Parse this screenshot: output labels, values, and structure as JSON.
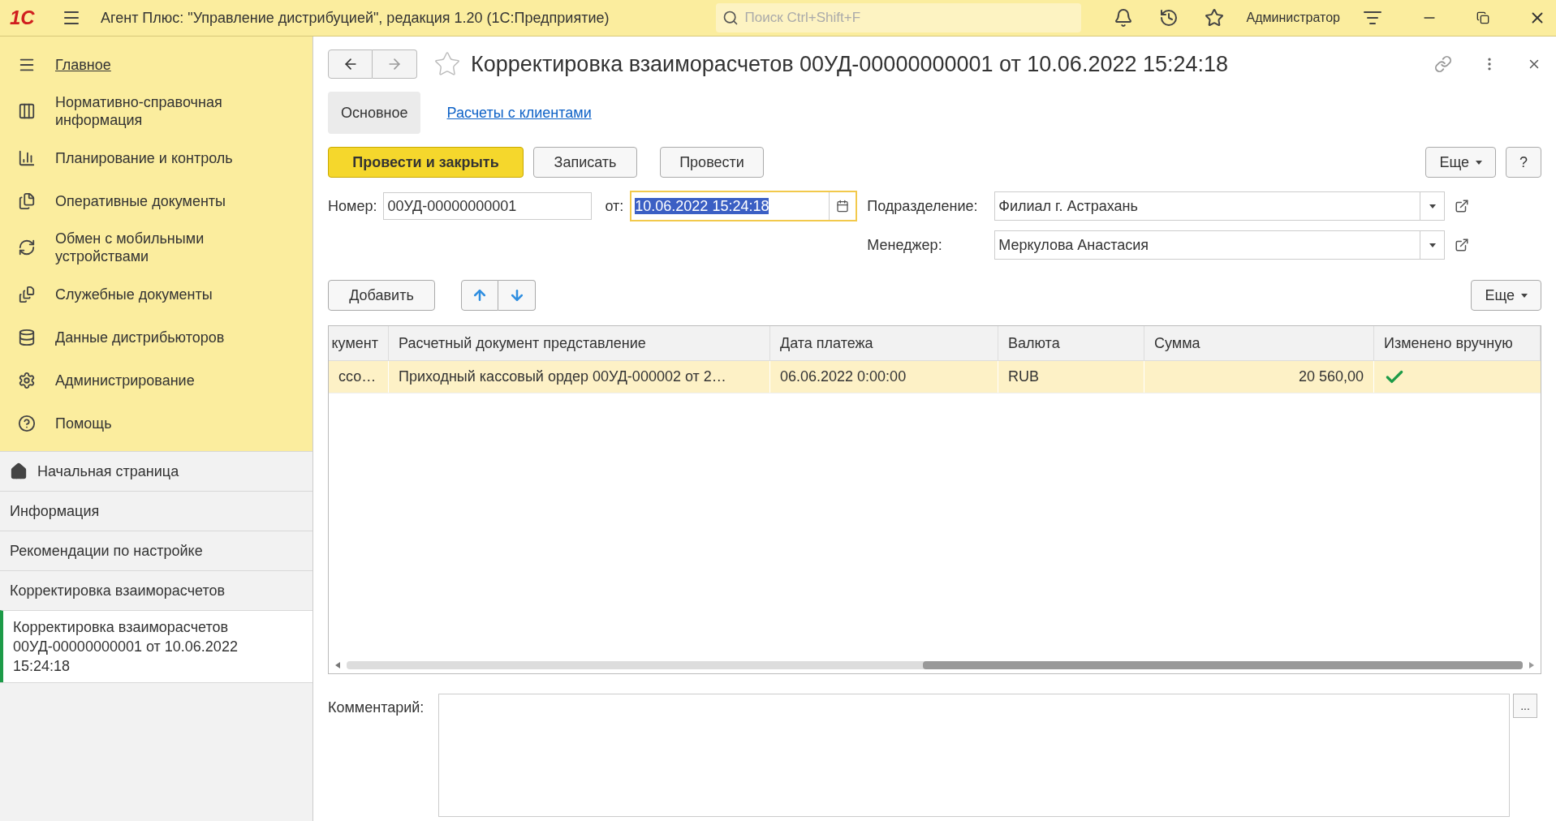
{
  "window": {
    "logo": "1С",
    "title": "Агент Плюс: \"Управление дистрибуцией\", редакция 1.20  (1С:Предприятие)",
    "search": {
      "placeholder": "Поиск Ctrl+Shift+F"
    },
    "user": "Администратор"
  },
  "sections": [
    {
      "label": "Главное",
      "selected": true
    },
    {
      "label": "Нормативно-справочная информация",
      "selected": false
    },
    {
      "label": "Планирование и контроль",
      "selected": false
    },
    {
      "label": "Оперативные документы",
      "selected": false
    },
    {
      "label": "Обмен с мобильными устройствами",
      "selected": false
    },
    {
      "label": "Служебные документы",
      "selected": false
    },
    {
      "label": "Данные дистрибьюторов",
      "selected": false
    },
    {
      "label": "Администрирование",
      "selected": false
    },
    {
      "label": "Помощь",
      "selected": false
    }
  ],
  "open_windows": [
    {
      "label": "Начальная страница",
      "kind": "home",
      "selected": false
    },
    {
      "label": "Информация",
      "kind": "page",
      "selected": false
    },
    {
      "label": "Рекомендации по настройке",
      "kind": "page",
      "selected": false
    },
    {
      "label": "Корректировка взаиморасчетов",
      "kind": "page",
      "selected": false
    },
    {
      "label": "Корректировка взаиморасчетов 00УД-00000000001 от 10.06.2022 15:24:18",
      "kind": "page",
      "selected": true
    }
  ],
  "document": {
    "title": "Корректировка взаиморасчетов 00УД-00000000001 от 10.06.2022 15:24:18",
    "tabs": [
      {
        "label": "Основное",
        "selected": true
      },
      {
        "label": "Расчеты с клиентами",
        "selected": false
      }
    ],
    "commands": [
      {
        "label": "Провести и закрыть",
        "kind": "primary"
      },
      {
        "label": "Записать",
        "kind": "normal"
      },
      {
        "label": "Провести",
        "kind": "normal"
      }
    ],
    "more": "Еще",
    "help": "?",
    "number": {
      "label": "Номер:",
      "value": "00УД-00000000001"
    },
    "date": {
      "label": "от:",
      "value": "10.06.2022 15:24:18",
      "focused": true
    },
    "division": {
      "label": "Подразделение:",
      "value": "Филиал г. Астрахань"
    },
    "manager": {
      "label": "Менеджер:",
      "value": "Меркулова Анастасия"
    },
    "add": "Добавить",
    "table_more": "Еще",
    "table": {
      "columns": [
        "кумент",
        "Расчетный документ представление",
        "Дата платежа",
        "Валюта",
        "Сумма",
        "Изменено вручную"
      ],
      "rows": [
        {
          "cells": [
            "ссо…",
            "Приходный кассовый ордер 00УД-000002 от 2…",
            "06.06.2022 0:00:00",
            "RUB",
            "20 560,00"
          ],
          "changed_manually": true,
          "selected": true
        }
      ]
    },
    "comment": {
      "label": "Комментарий:",
      "button": "..."
    }
  }
}
